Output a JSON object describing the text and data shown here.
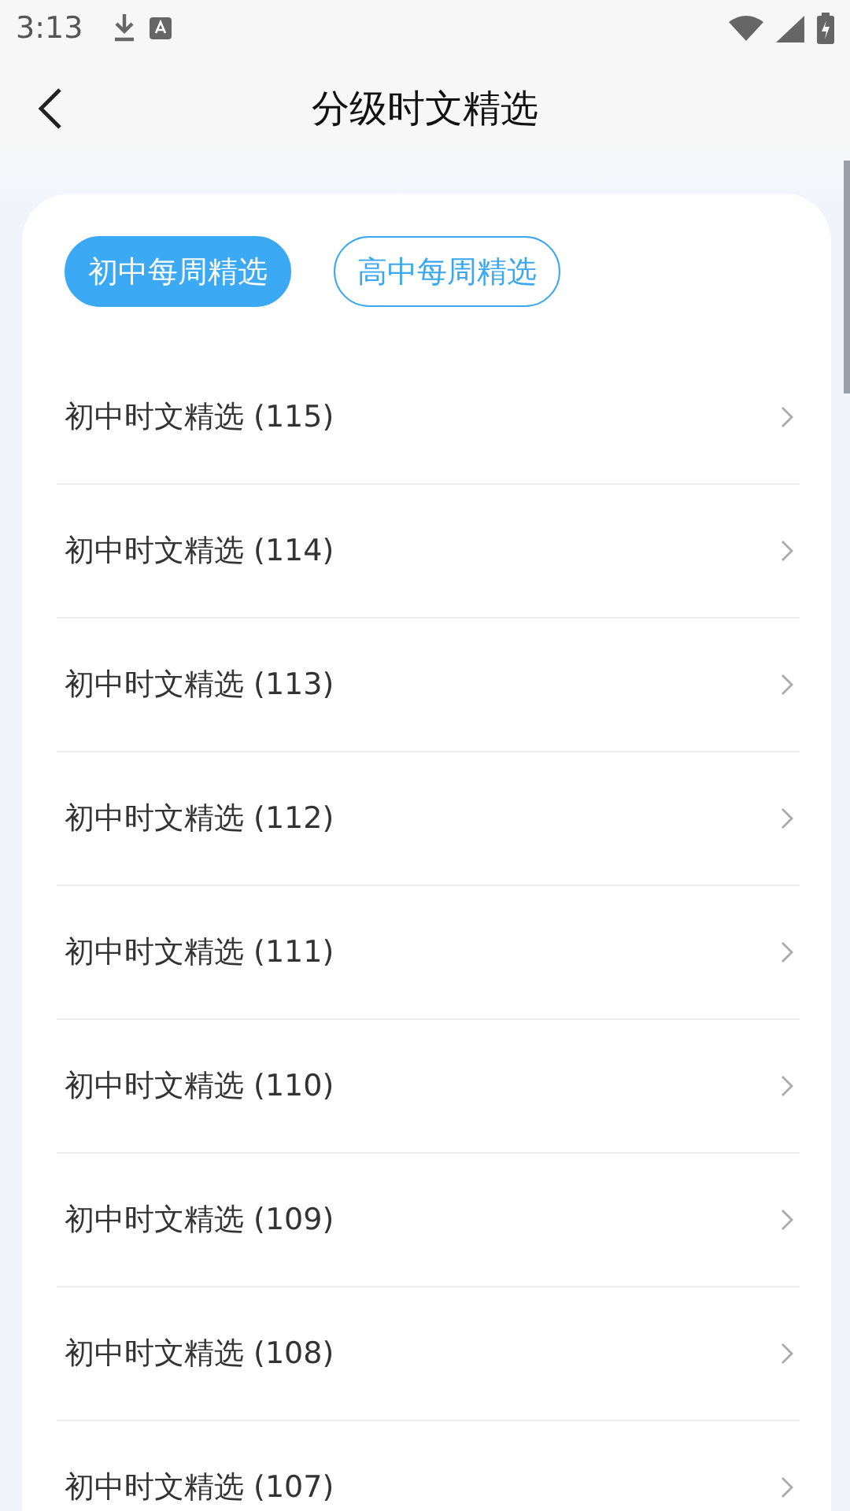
{
  "status_bar": {
    "time": "3:13"
  },
  "header": {
    "title": "分级时文精选"
  },
  "tabs": [
    {
      "label": "初中每周精选",
      "selected": true
    },
    {
      "label": "高中每周精选",
      "selected": false
    }
  ],
  "items": [
    {
      "title": "初中时文精选 (115)"
    },
    {
      "title": "初中时文精选 (114)"
    },
    {
      "title": "初中时文精选 (113)"
    },
    {
      "title": "初中时文精选 (112)"
    },
    {
      "title": "初中时文精选 (111)"
    },
    {
      "title": "初中时文精选 (110)"
    },
    {
      "title": "初中时文精选 (109)"
    },
    {
      "title": "初中时文精选 (108)"
    },
    {
      "title": "初中时文精选 (107)"
    }
  ]
}
